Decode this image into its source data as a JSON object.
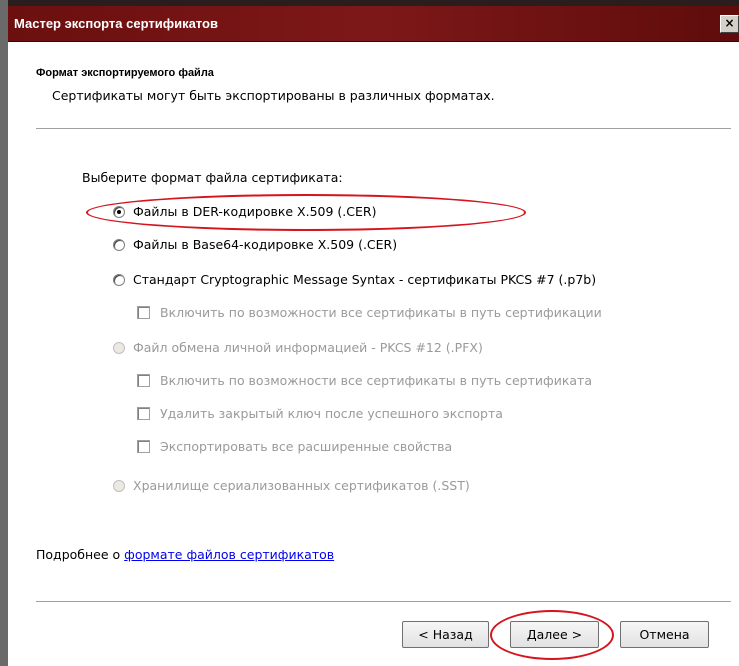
{
  "window": {
    "title": "Мастер экспорта сертификатов",
    "close_glyph": "×"
  },
  "header": {
    "title": "Формат экспортируемого файла",
    "subtitle": "Сертификаты могут быть экспортированы в различных форматах."
  },
  "format": {
    "prompt": "Выберите формат файла сертификата:",
    "options": [
      {
        "label": "Файлы в DER-кодировке X.509 (.CER)",
        "checked": true,
        "enabled": true
      },
      {
        "label": "Файлы в Base64-кодировке X.509 (.CER)",
        "checked": false,
        "enabled": true
      },
      {
        "label": "Стандарт Cryptographic Message Syntax - сертификаты PKCS #7 (.p7b)",
        "checked": false,
        "enabled": true
      },
      {
        "label": "Файл обмена личной информацией - PKCS #12 (.PFX)",
        "checked": false,
        "enabled": false
      },
      {
        "label": "Хранилище сериализованных сертификатов (.SST)",
        "checked": false,
        "enabled": false
      }
    ],
    "p7b_checkbox": {
      "label": "Включить по возможности все сертификаты в путь сертификации",
      "checked": false,
      "enabled": false
    },
    "pfx_checkboxes": [
      {
        "label": "Включить по возможности все сертификаты в путь сертификата",
        "checked": false,
        "enabled": false
      },
      {
        "label": "Удалить закрытый ключ после успешного экспорта",
        "checked": false,
        "enabled": false
      },
      {
        "label": "Экспортировать все расширенные свойства",
        "checked": false,
        "enabled": false
      }
    ]
  },
  "more_info": {
    "prefix": "Подробнее о ",
    "link": "формате файлов сертификатов"
  },
  "buttons": {
    "back": "< Назад",
    "next": "Далее >",
    "cancel": "Отмена"
  },
  "highlight_color": "#d4141e"
}
